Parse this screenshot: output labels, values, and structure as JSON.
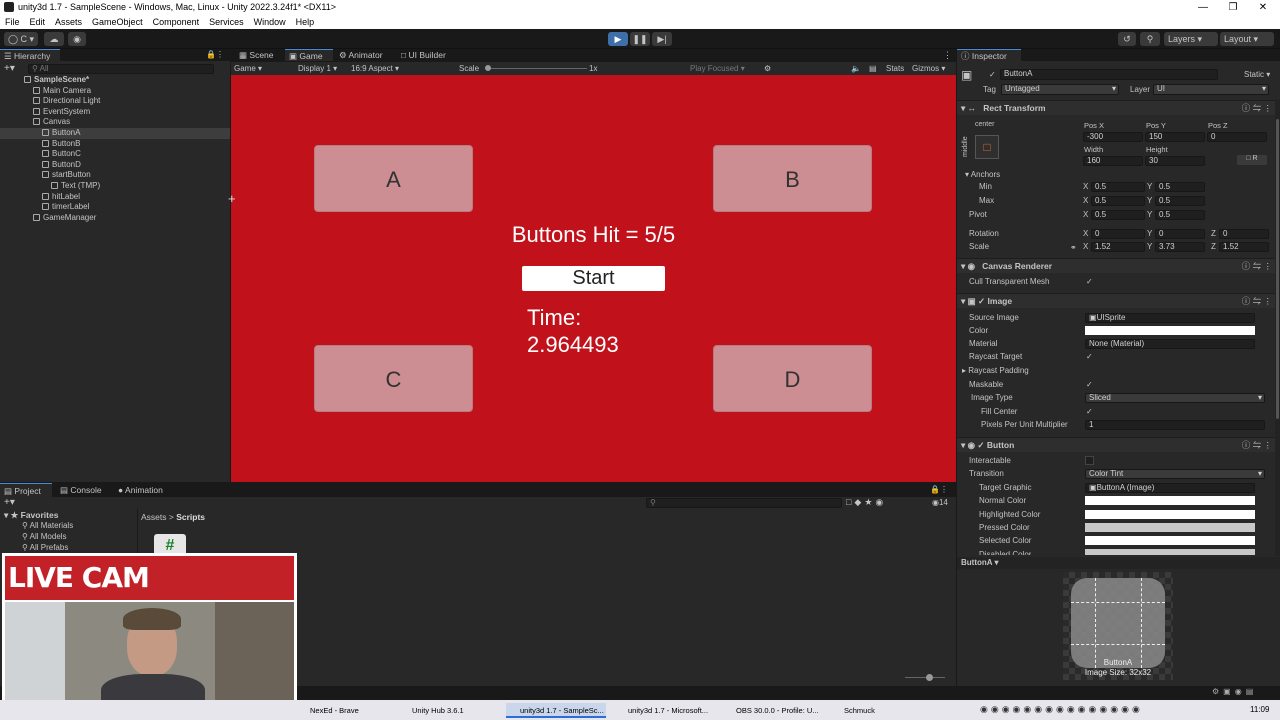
{
  "window": {
    "title": "unity3d 1.7 - SampleScene - Windows, Mac, Linux - Unity 2022.3.24f1* <DX11>"
  },
  "menu": [
    "File",
    "Edit",
    "Assets",
    "GameObject",
    "Component",
    "Services",
    "Window",
    "Help"
  ],
  "toolbar": {
    "account": "C",
    "layers": "Layers",
    "layout": "Layout"
  },
  "hierarchy": {
    "tab": "Hierarchy",
    "search_placeholder": "All",
    "items": [
      {
        "label": "SampleScene*",
        "indent": 0,
        "bold": true
      },
      {
        "label": "Main Camera",
        "indent": 1
      },
      {
        "label": "Directional Light",
        "indent": 1
      },
      {
        "label": "EventSystem",
        "indent": 1
      },
      {
        "label": "Canvas",
        "indent": 1
      },
      {
        "label": "ButtonA",
        "indent": 2,
        "selected": true
      },
      {
        "label": "ButtonB",
        "indent": 2
      },
      {
        "label": "ButtonC",
        "indent": 2
      },
      {
        "label": "ButtonD",
        "indent": 2
      },
      {
        "label": "startButton",
        "indent": 2
      },
      {
        "label": "Text (TMP)",
        "indent": 3
      },
      {
        "label": "hitLabel",
        "indent": 2
      },
      {
        "label": "timerLabel",
        "indent": 2
      },
      {
        "label": "GameManager",
        "indent": 1
      }
    ]
  },
  "view_tabs": [
    "Scene",
    "Game",
    "Animator",
    "UI Builder"
  ],
  "game_bar": {
    "mode": "Game",
    "display": "Display 1",
    "aspect": "16:9 Aspect",
    "scale_label": "Scale",
    "scale_value": "1x",
    "play_focused": "Play Focused",
    "stats": "Stats",
    "gizmos": "Gizmos"
  },
  "game": {
    "buttons": {
      "a": "A",
      "b": "B",
      "c": "C",
      "d": "D"
    },
    "hits": "Buttons Hit = 5/5",
    "start": "Start",
    "time_label": "Time:",
    "time_value": "2.964493",
    "bg_color": "#c1121c"
  },
  "project": {
    "tabs": [
      "Project",
      "Console",
      "Animation"
    ],
    "favorites": "Favorites",
    "fav_items": [
      "All Materials",
      "All Models",
      "All Prefabs"
    ],
    "breadcrumb_root": "Assets",
    "breadcrumb_leaf": "Scripts",
    "count": "14"
  },
  "inspector": {
    "tab": "Inspector",
    "name": "ButtonA",
    "static": "Static",
    "tag_label": "Tag",
    "tag": "Untagged",
    "layer_label": "Layer",
    "layer": "UI",
    "rect_transform": "Rect Transform",
    "anchor_h": "center",
    "anchor_v": "middle",
    "posx_label": "Pos X",
    "posy_label": "Pos Y",
    "posz_label": "Pos Z",
    "posx": "-300",
    "posy": "150",
    "posz": "0",
    "width_label": "Width",
    "height_label": "Height",
    "width": "160",
    "height": "30",
    "anchors": "Anchors",
    "min": "Min",
    "max": "Max",
    "pivot": "Pivot",
    "rotation": "Rotation",
    "scale": "Scale",
    "x": "X",
    "y": "Y",
    "z": "Z",
    "min_x": "0.5",
    "min_y": "0.5",
    "max_x": "0.5",
    "max_y": "0.5",
    "pivot_x": "0.5",
    "pivot_y": "0.5",
    "rot_x": "0",
    "rot_y": "0",
    "rot_z": "0",
    "scale_x": "1.52",
    "scale_y": "3.73",
    "scale_z": "1.52",
    "canvas_renderer": "Canvas Renderer",
    "cull": "Cull Transparent Mesh",
    "image": "Image",
    "source_image_label": "Source Image",
    "source_image": "UISprite",
    "color_label": "Color",
    "material_label": "Material",
    "material": "None (Material)",
    "raycast_target": "Raycast Target",
    "raycast_padding": "Raycast Padding",
    "maskable": "Maskable",
    "image_type_label": "Image Type",
    "image_type": "Sliced",
    "fill_center": "Fill Center",
    "ppu_label": "Pixels Per Unit Multiplier",
    "ppu": "1",
    "button": "Button",
    "interactable": "Interactable",
    "transition_label": "Transition",
    "transition": "Color Tint",
    "target_graphic_label": "Target Graphic",
    "target_graphic": "ButtonA (Image)",
    "normal": "Normal Color",
    "highlighted": "Highlighted Color",
    "pressed": "Pressed Color",
    "selected": "Selected Color",
    "disabled": "Disabled Color",
    "preview_title": "ButtonA",
    "preview_name": "ButtonA",
    "preview_size": "Image Size: 32x32"
  },
  "livecam": {
    "banner": "LIVE CAM REACTION"
  },
  "taskbar": {
    "items": [
      "NexEd - Brave",
      "Unity Hub 3.6.1",
      "unity3d 1.7 - SampleSc...",
      "unity3d 1.7 - Microsoft...",
      "OBS 30.0.0 - Profile: U...",
      "Schmuck"
    ],
    "clock": "11:09"
  }
}
